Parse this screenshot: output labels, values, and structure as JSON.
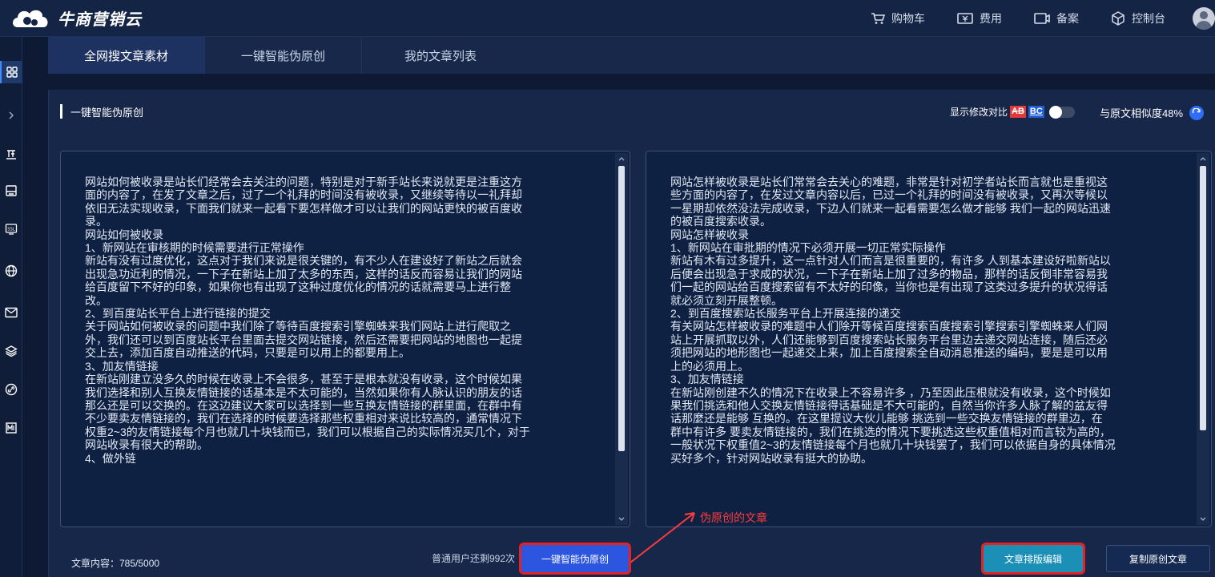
{
  "app": {
    "brand": "牛商营销云"
  },
  "topnav": [
    {
      "label": "购物车",
      "icon": "cart-icon"
    },
    {
      "label": "费用",
      "icon": "fee-icon"
    },
    {
      "label": "备案",
      "icon": "filing-icon"
    },
    {
      "label": "控制台",
      "icon": "console-icon"
    }
  ],
  "tabs": [
    {
      "label": "全网搜文章素材",
      "active": true
    },
    {
      "label": "一键智能伪原创",
      "active": false
    },
    {
      "label": "我的文章列表",
      "active": false
    }
  ],
  "card": {
    "title": "一键智能伪原创",
    "diff_label": "显示修改对比",
    "diff_badge_a": "AB",
    "diff_badge_b": "BC",
    "similarity_label": "与原文相似度48%"
  },
  "left_text": "网站如何被收录是站长们经常会去关注的问题，特别是对于新手站长来说就更是注重这方\n面的内容了，在发了文章之后，过了一个礼拜的时间没有被收录，又继续等待以一礼拜却\n依旧无法实现收录，下面我们就来一起看下要怎样做才可以让我们的网站更快的被百度收\n录。\n网站如何被收录\n1、新网站在审核期的时候需要进行正常操作\n新站有没有过度优化，这点对于我们来说是很关键的，有不少人在建设好了新站之后就会\n出现急功近利的情况，一下子在新站上加了太多的东西，这样的话反而容易让我们的网站\n给百度留下不好的印象，如果你也有出现了这种过度优化的情况的话就需要马上进行整\n改。\n2、到百度站长平台上进行链接的提交\n关于网站如何被收录的问题中我们除了等待百度搜索引擎蜘蛛来我们网站上进行爬取之\n外，我们还可以到百度站长平台里面去提交网站链接，然后还需要把网站的地图也一起提\n交上去，添加百度自动推送的代码，只要是可以用上的都要用上。\n3、加友情链接\n在新站刚建立没多久的时候在收录上不会很多，甚至于是根本就没有收录，这个时候如果\n我们选择和别人互换友情链接的话基本是不太可能的，当然如果你有人脉认识的朋友的话\n那么还是可以交换的。在这边建议大家可以选择到一些互换友情链接的群里面，在群中有\n不少要卖友情链接的，我们在选择的时候要选择那些权重相对来说比较高的，通常情况下\n权重2~3的友情链接每个月也就几十块钱而已，我们可以根据自己的实际情况买几个，对于\n网站收录有很大的帮助。\n4、做外链",
  "right_text": "网站怎样被收录是站长们常常会去关心的难题，非常是针对初学者站长而言就也是重视这\n些方面的内容了，在发过文章内容以后，已过一个礼拜的时间没有被收录，又再次等候以\n一星期却依然没法完成收录，下边人们就来一起看需要怎么做才能够 我们一起的网站迅速\n的被百度搜索收录。\n网站怎样被收录\n1、新网站在审批期的情况下必须开展一切正常实际操作\n新站有木有过多提升，这一点针对人们而言是很重要的，有许多 人到基本建设好啦新站以\n后便会出现急于求成的状况，一下子在新站上加了过多的物品，那样的话反倒非常容易我\n们一起的网站给百度搜索留有不太好的印像，当你也是有出现了这类过多提升的状况得话\n就必须立刻开展整顿。\n2、到百度搜索站长服务平台上开展连接的递交\n有关网站怎样被收录的难题中人们除开等候百度搜索百度搜索引擎搜索引擎蜘蛛来人们网\n站上开展抓取以外，人们还能够到百度搜索站长服务平台里边去递交网站连接，随后还必\n须把网站的地形图也一起递交上来，加上百度搜索全自动消息推送的编码，要是是可以用\n上的必须用上。\n3、加友情链接\n在新站刚创建不久的情况下在收录上不容易许多 ，乃至因此压根就没有收录，这个时候如\n果我们挑选和他人交换友情链接得话基础是不大可能的，自然当你许多人脉了解的盆友得\n话那麼还是能够 互换的。在这里提议大伙儿能够 挑选到一些交换友情链接的群里边，在\n群中有许多 要卖友情链接的，我们在挑选的情况下要挑选这些权重值相对而言较为高的，\n一般状况下权重值2~3的友情链接每个月也就几十块钱罢了，我们可以依据自身的具体情况\n买好多个，针对网站收录有挺大的协助。",
  "annotation": "伪原创的文章",
  "footer": {
    "count": "文章内容：785/5000",
    "remaining": "普通用户还剩992次",
    "primary_button": "一键智能伪原创",
    "layout_button": "文章排版编辑",
    "copy_button": "复制原创文章"
  }
}
